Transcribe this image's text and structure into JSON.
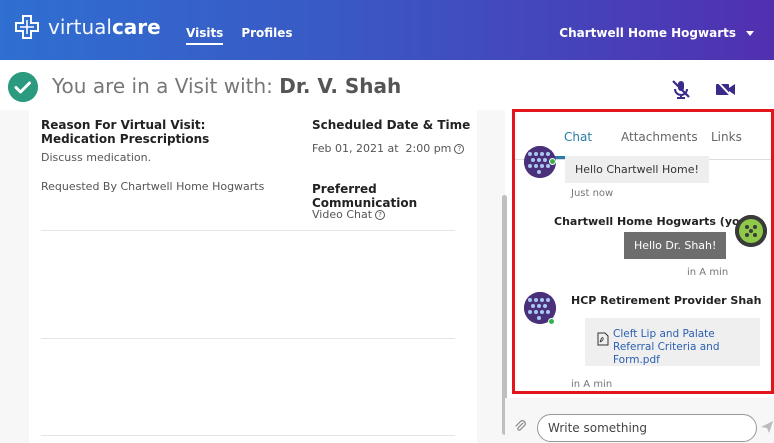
{
  "header": {
    "logo_light": "virtual",
    "logo_bold": "care",
    "nav": [
      {
        "label": "Visits"
      },
      {
        "label": "Profiles"
      }
    ],
    "account_name": "Chartwell Home Hogwarts"
  },
  "visit": {
    "title_prefix": "You are in a Visit with: ",
    "doctor": "Dr. V. Shah"
  },
  "details": {
    "reason_label": "Reason For Virtual Visit: Medication Prescriptions",
    "reason_text": "Discuss medication.",
    "requested_by": "Requested By Chartwell Home Hogwarts",
    "scheduled_label": "Scheduled Date & Time",
    "scheduled_value": "Feb 01, 2021 at  2:00 pm",
    "preferred_label": "Preferred Communication",
    "preferred_value": "Video Chat"
  },
  "chat": {
    "tabs": [
      {
        "label": "Chat"
      },
      {
        "label": "Attachments"
      },
      {
        "label": "Links"
      }
    ],
    "messages": [
      {
        "text": "Hello Chartwell Home!",
        "time": "Just now"
      },
      {
        "sender": "Chartwell Home Hogwarts (you)",
        "text": "Hello Dr. Shah!",
        "time": "in A min"
      },
      {
        "sender": "HCP Retirement Provider Shah",
        "file": "Cleft Lip and Palate Referral Criteria and Form.pdf",
        "time": "in A min"
      }
    ],
    "input_placeholder": "Write something"
  },
  "colors": {
    "accent": "#2b7ca4",
    "highlight_border": "#e3141c",
    "online": "#34b24a"
  }
}
